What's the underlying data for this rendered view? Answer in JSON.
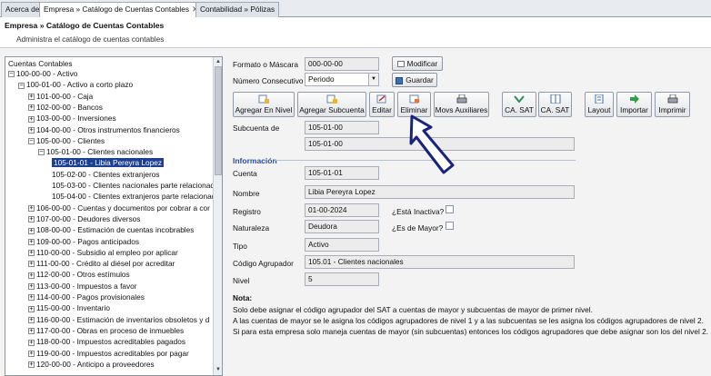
{
  "tabs": [
    {
      "label": "Acerca de",
      "active": false
    },
    {
      "label": "Empresa » Catálogo de Cuentas Contables",
      "active": true
    },
    {
      "label": "Contabilidad » Pólizas",
      "active": false
    }
  ],
  "header": {
    "title": "Empresa » Catálogo de Cuentas Contables",
    "subtitle": "Administra el catálogo de cuentas contables"
  },
  "tree": {
    "title": "Cuentas Contables",
    "nodes": [
      {
        "label": "100-00-00 - Activo",
        "expander": "⊟"
      },
      {
        "label": "100-01-00 - Activo a corto plazo",
        "expander": "⊟"
      },
      {
        "label": "101-00-00 - Caja",
        "expander": "⊞"
      },
      {
        "label": "102-00-00 - Bancos",
        "expander": "⊞"
      },
      {
        "label": "103-00-00 - Inversiones",
        "expander": "⊞"
      },
      {
        "label": "104-00-00 - Otros instrumentos financieros",
        "expander": "⊞"
      },
      {
        "label": "105-00-00 - Clientes",
        "expander": "⊟"
      },
      {
        "label": "105-01-00 - Clientes nacionales",
        "expander": "⊟"
      },
      {
        "label": "105-01-01 - Libia Pereyra Lopez",
        "expander": ""
      },
      {
        "label": "105-02-00 - Clientes extranjeros",
        "expander": ""
      },
      {
        "label": "105-03-00 - Clientes nacionales parte relacionad",
        "expander": ""
      },
      {
        "label": "105-04-00 - Clientes extranjeros parte relacionad",
        "expander": ""
      },
      {
        "label": "106-00-00 - Cuentas y documentos por cobrar a cor",
        "expander": "⊞"
      },
      {
        "label": "107-00-00 - Deudores diversos",
        "expander": "⊞"
      },
      {
        "label": "108-00-00 - Estimación de cuentas incobrables",
        "expander": "⊞"
      },
      {
        "label": "109-00-00 - Pagos anticipados",
        "expander": "⊞"
      },
      {
        "label": "110-00-00 - Subsidio al empleo por aplicar",
        "expander": "⊞"
      },
      {
        "label": "111-00-00 - Crédito al diésel por acreditar",
        "expander": "⊞"
      },
      {
        "label": "112-00-00 - Otros estímulos",
        "expander": "⊞"
      },
      {
        "label": "113-00-00 - Impuestos a favor",
        "expander": "⊞"
      },
      {
        "label": "114-00-00 - Pagos provisionales",
        "expander": "⊞"
      },
      {
        "label": "115-00-00 - Inventario",
        "expander": "⊞"
      },
      {
        "label": "116-00-00 - Estimación de inventarios obsoletos y d",
        "expander": "⊞"
      },
      {
        "label": "117-00-00 - Obras en proceso de inmuebles",
        "expander": "⊞"
      },
      {
        "label": "118-00-00 - Impuestos acreditables pagados",
        "expander": "⊞"
      },
      {
        "label": "119-00-00 - Impuestos acreditables por pagar",
        "expander": "⊞"
      },
      {
        "label": "120-00-00 - Anticipo a proveedores",
        "expander": "⊞"
      }
    ]
  },
  "form": {
    "formato_label": "Formato o Máscara",
    "formato_value": "000-00-00",
    "modificar_label": "Modificar",
    "consecutivo_label": "Número Consecutivo",
    "consecutivo_value": "Periodo",
    "guardar_label": "Guardar",
    "subcuenta_label": "Subcuenta de",
    "subcuenta_value": "105-01-00",
    "subcuenta_value2": "105-01-00",
    "section_label": "Información",
    "cuenta_label": "Cuenta",
    "cuenta_value": "105-01-01",
    "nombre_label": "Nombre",
    "nombre_value": "Libia Pereyra Lopez",
    "registro_label": "Registro",
    "registro_value": "01-00-2024",
    "inactiva_label": "¿Está Inactiva?",
    "naturaleza_label": "Naturaleza",
    "naturaleza_value": "Deudora",
    "mayor_label": "¿Es de Mayor?",
    "tipo_label": "Tipo",
    "tipo_value": "Activo",
    "agrupador_label": "Código Agrupador",
    "agrupador_value": "105.01 - Clientes nacionales",
    "nivel_label": "Nivel",
    "nivel_value": "5"
  },
  "toolbar": [
    {
      "label": "Agregar En Nivel",
      "icon": "add-level-icon"
    },
    {
      "label": "Agregar Subcuenta",
      "icon": "add-subaccount-icon"
    },
    {
      "label": "Editar",
      "icon": "edit-icon"
    },
    {
      "label": "Eliminar",
      "icon": "delete-icon"
    },
    {
      "label": "Movs Auxiliares",
      "icon": "print-icon"
    },
    {
      "label": "CA. SAT",
      "icon": "sat-check-icon"
    },
    {
      "label": "CA. SAT",
      "icon": "sat-grid-icon"
    },
    {
      "label": "Layout",
      "icon": "layout-icon"
    },
    {
      "label": "Importar",
      "icon": "import-arrow-icon"
    },
    {
      "label": "Imprimir",
      "icon": "printer-icon"
    }
  ],
  "nota": {
    "title": "Nota:",
    "lines": [
      "Solo debe asignar el código agrupador del SAT a cuentas de mayor y subcuentas de mayor de primer nivel.",
      "A las cuentas de mayor se le asigna los códigos agrupadores de nivel 1 y a las subcuentas se les asigna los códigos agrupadores de nivel 2.",
      "Si para esta empresa solo maneja cuentas de mayor (sin subcuentas) entonces los códigos agrupadores que debe asignar son los del nivel 2."
    ]
  },
  "colors": {
    "selection": "#1c3f94",
    "section": "#2a4e9c",
    "arrow": "#1a237e"
  }
}
